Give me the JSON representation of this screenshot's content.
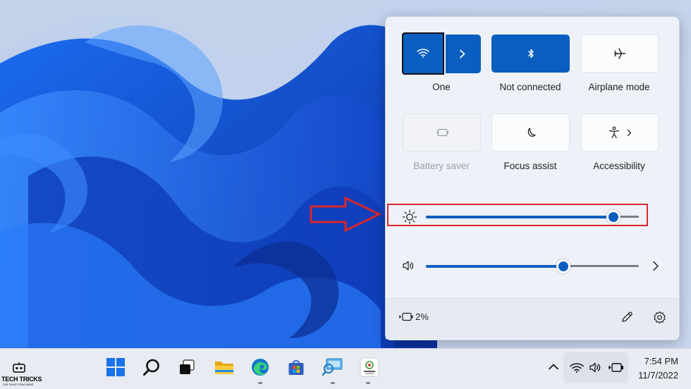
{
  "quick_settings": {
    "tiles": [
      {
        "id": "wifi",
        "label": "One",
        "state": "on",
        "icon": "wifi-icon"
      },
      {
        "id": "bluetooth",
        "label": "Not connected",
        "state": "on",
        "icon": "bluetooth-icon"
      },
      {
        "id": "airplane",
        "label": "Airplane mode",
        "state": "off",
        "icon": "airplane-icon"
      },
      {
        "id": "battery_saver",
        "label": "Battery saver",
        "state": "disabled",
        "icon": "battery-saver-icon"
      },
      {
        "id": "focus_assist",
        "label": "Focus assist",
        "state": "off",
        "icon": "moon-icon"
      },
      {
        "id": "accessibility",
        "label": "Accessibility",
        "state": "off",
        "icon": "accessibility-icon"
      }
    ],
    "brightness": {
      "value": 0.88,
      "icon": "brightness-icon"
    },
    "volume": {
      "value": 0.645,
      "icon": "speaker-icon"
    },
    "battery_percent": "2%",
    "footer_icons": [
      "edit-icon",
      "settings-icon"
    ]
  },
  "taskbar": {
    "pinned": [
      "start-icon",
      "search-icon",
      "task-view-icon",
      "file-explorer-icon",
      "edge-icon",
      "store-icon",
      "snipping-tool-icon",
      "app-icon"
    ],
    "time": "7:54 PM",
    "date": "11/7/2022"
  },
  "watermark": {
    "title": "TECH TRICKS",
    "subtitle": "THỦ THUẬT CÔNG NGHỆ"
  },
  "colors": {
    "accent": "#0a5ec0",
    "annotation": "#d8262e"
  }
}
